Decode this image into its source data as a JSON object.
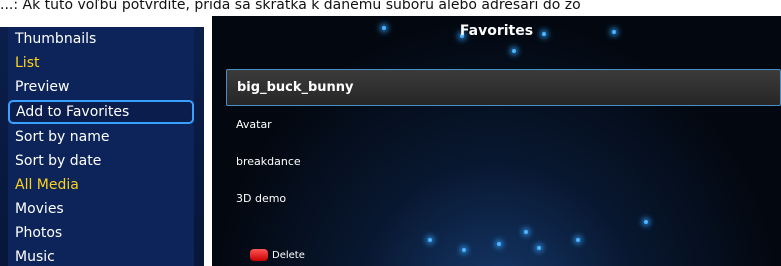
{
  "caption": "...: Ak túto voľbu potvrdíte, pridá sa skratka k danému súboru alebo adresári do zo",
  "menu": {
    "view_items": [
      "Thumbnails",
      "List",
      "Preview"
    ],
    "action_items": [
      "Add to Favorites",
      "Sort by name",
      "Sort by date"
    ],
    "media_items": [
      "All Media",
      "Movies",
      "Photos",
      "Music"
    ],
    "active_view": "List",
    "focused_action": "Add to Favorites",
    "active_media": "All Media"
  },
  "favorites": {
    "title": "Favorites",
    "items": [
      "big_buck_bunny",
      "Avatar",
      "breakdance",
      "3D demo"
    ],
    "selected": "big_buck_bunny",
    "footer": {
      "key_icon": "red-key-icon",
      "key_color": "#e01010",
      "delete_label": "Delete"
    }
  },
  "colors": {
    "menu_bg": "#0b1f4a",
    "active_text": "#ffd21c",
    "focus_border": "#3aa0ff"
  }
}
